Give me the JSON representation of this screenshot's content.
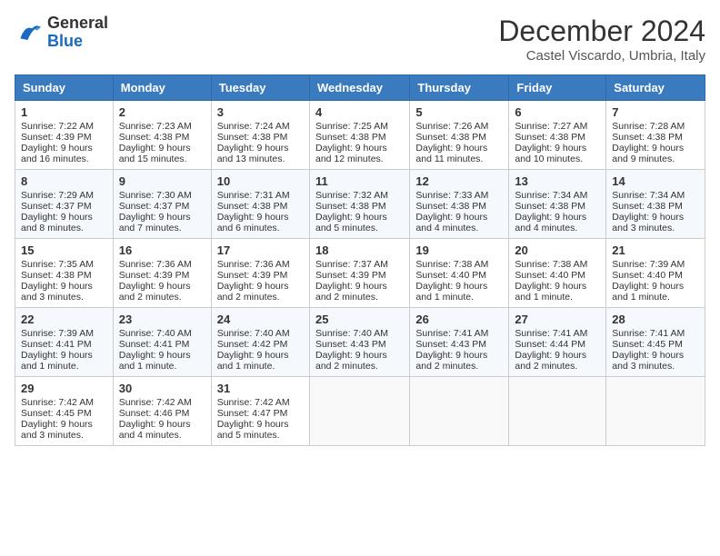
{
  "logo": {
    "line1": "General",
    "line2": "Blue"
  },
  "title": "December 2024",
  "location": "Castel Viscardo, Umbria, Italy",
  "headers": [
    "Sunday",
    "Monday",
    "Tuesday",
    "Wednesday",
    "Thursday",
    "Friday",
    "Saturday"
  ],
  "weeks": [
    [
      {
        "day": "1",
        "sunrise": "7:22 AM",
        "sunset": "4:39 PM",
        "daylight": "9 hours and 16 minutes."
      },
      {
        "day": "2",
        "sunrise": "7:23 AM",
        "sunset": "4:38 PM",
        "daylight": "9 hours and 15 minutes."
      },
      {
        "day": "3",
        "sunrise": "7:24 AM",
        "sunset": "4:38 PM",
        "daylight": "9 hours and 13 minutes."
      },
      {
        "day": "4",
        "sunrise": "7:25 AM",
        "sunset": "4:38 PM",
        "daylight": "9 hours and 12 minutes."
      },
      {
        "day": "5",
        "sunrise": "7:26 AM",
        "sunset": "4:38 PM",
        "daylight": "9 hours and 11 minutes."
      },
      {
        "day": "6",
        "sunrise": "7:27 AM",
        "sunset": "4:38 PM",
        "daylight": "9 hours and 10 minutes."
      },
      {
        "day": "7",
        "sunrise": "7:28 AM",
        "sunset": "4:38 PM",
        "daylight": "9 hours and 9 minutes."
      }
    ],
    [
      {
        "day": "8",
        "sunrise": "7:29 AM",
        "sunset": "4:37 PM",
        "daylight": "9 hours and 8 minutes."
      },
      {
        "day": "9",
        "sunrise": "7:30 AM",
        "sunset": "4:37 PM",
        "daylight": "9 hours and 7 minutes."
      },
      {
        "day": "10",
        "sunrise": "7:31 AM",
        "sunset": "4:38 PM",
        "daylight": "9 hours and 6 minutes."
      },
      {
        "day": "11",
        "sunrise": "7:32 AM",
        "sunset": "4:38 PM",
        "daylight": "9 hours and 5 minutes."
      },
      {
        "day": "12",
        "sunrise": "7:33 AM",
        "sunset": "4:38 PM",
        "daylight": "9 hours and 4 minutes."
      },
      {
        "day": "13",
        "sunrise": "7:34 AM",
        "sunset": "4:38 PM",
        "daylight": "9 hours and 4 minutes."
      },
      {
        "day": "14",
        "sunrise": "7:34 AM",
        "sunset": "4:38 PM",
        "daylight": "9 hours and 3 minutes."
      }
    ],
    [
      {
        "day": "15",
        "sunrise": "7:35 AM",
        "sunset": "4:38 PM",
        "daylight": "9 hours and 3 minutes."
      },
      {
        "day": "16",
        "sunrise": "7:36 AM",
        "sunset": "4:39 PM",
        "daylight": "9 hours and 2 minutes."
      },
      {
        "day": "17",
        "sunrise": "7:36 AM",
        "sunset": "4:39 PM",
        "daylight": "9 hours and 2 minutes."
      },
      {
        "day": "18",
        "sunrise": "7:37 AM",
        "sunset": "4:39 PM",
        "daylight": "9 hours and 2 minutes."
      },
      {
        "day": "19",
        "sunrise": "7:38 AM",
        "sunset": "4:40 PM",
        "daylight": "9 hours and 1 minute."
      },
      {
        "day": "20",
        "sunrise": "7:38 AM",
        "sunset": "4:40 PM",
        "daylight": "9 hours and 1 minute."
      },
      {
        "day": "21",
        "sunrise": "7:39 AM",
        "sunset": "4:40 PM",
        "daylight": "9 hours and 1 minute."
      }
    ],
    [
      {
        "day": "22",
        "sunrise": "7:39 AM",
        "sunset": "4:41 PM",
        "daylight": "9 hours and 1 minute."
      },
      {
        "day": "23",
        "sunrise": "7:40 AM",
        "sunset": "4:41 PM",
        "daylight": "9 hours and 1 minute."
      },
      {
        "day": "24",
        "sunrise": "7:40 AM",
        "sunset": "4:42 PM",
        "daylight": "9 hours and 1 minute."
      },
      {
        "day": "25",
        "sunrise": "7:40 AM",
        "sunset": "4:43 PM",
        "daylight": "9 hours and 2 minutes."
      },
      {
        "day": "26",
        "sunrise": "7:41 AM",
        "sunset": "4:43 PM",
        "daylight": "9 hours and 2 minutes."
      },
      {
        "day": "27",
        "sunrise": "7:41 AM",
        "sunset": "4:44 PM",
        "daylight": "9 hours and 2 minutes."
      },
      {
        "day": "28",
        "sunrise": "7:41 AM",
        "sunset": "4:45 PM",
        "daylight": "9 hours and 3 minutes."
      }
    ],
    [
      {
        "day": "29",
        "sunrise": "7:42 AM",
        "sunset": "4:45 PM",
        "daylight": "9 hours and 3 minutes."
      },
      {
        "day": "30",
        "sunrise": "7:42 AM",
        "sunset": "4:46 PM",
        "daylight": "9 hours and 4 minutes."
      },
      {
        "day": "31",
        "sunrise": "7:42 AM",
        "sunset": "4:47 PM",
        "daylight": "9 hours and 5 minutes."
      },
      null,
      null,
      null,
      null
    ]
  ]
}
